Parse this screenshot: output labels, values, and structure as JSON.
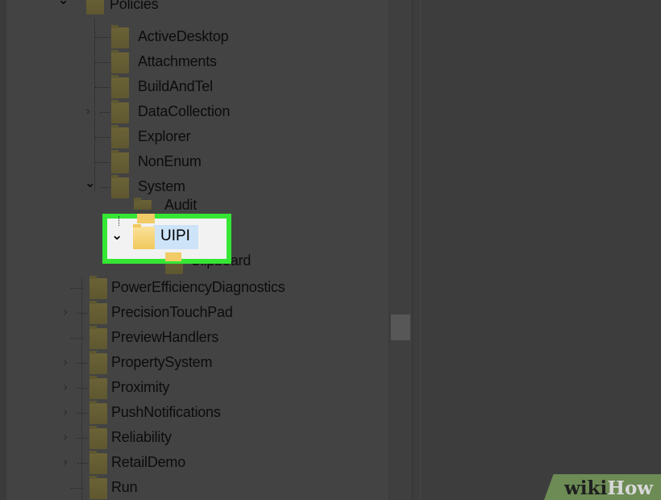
{
  "tree": {
    "policies_label": "Policies",
    "items": [
      {
        "label": "ActiveDesktop"
      },
      {
        "label": "Attachments"
      },
      {
        "label": "BuildAndTel"
      },
      {
        "label": "DataCollection"
      },
      {
        "label": "Explorer"
      },
      {
        "label": "NonEnum"
      },
      {
        "label": "System"
      }
    ],
    "audit_label": "Audit",
    "selected_label": "UIPI",
    "clipboard_label": "Clipboard",
    "siblings": [
      {
        "label": "PowerEfficiencyDiagnostics"
      },
      {
        "label": "PrecisionTouchPad"
      },
      {
        "label": "PreviewHandlers"
      },
      {
        "label": "PropertySystem"
      },
      {
        "label": "Proximity"
      },
      {
        "label": "PushNotifications"
      },
      {
        "label": "Reliability"
      },
      {
        "label": "RetailDemo"
      },
      {
        "label": "Run"
      }
    ]
  },
  "watermark": {
    "part1": "wiki",
    "part2": "How"
  },
  "colors": {
    "highlight": "#35e635",
    "selection": "#cde3f8",
    "folder": "#f0c85c",
    "dim_overlay": "#434343"
  }
}
